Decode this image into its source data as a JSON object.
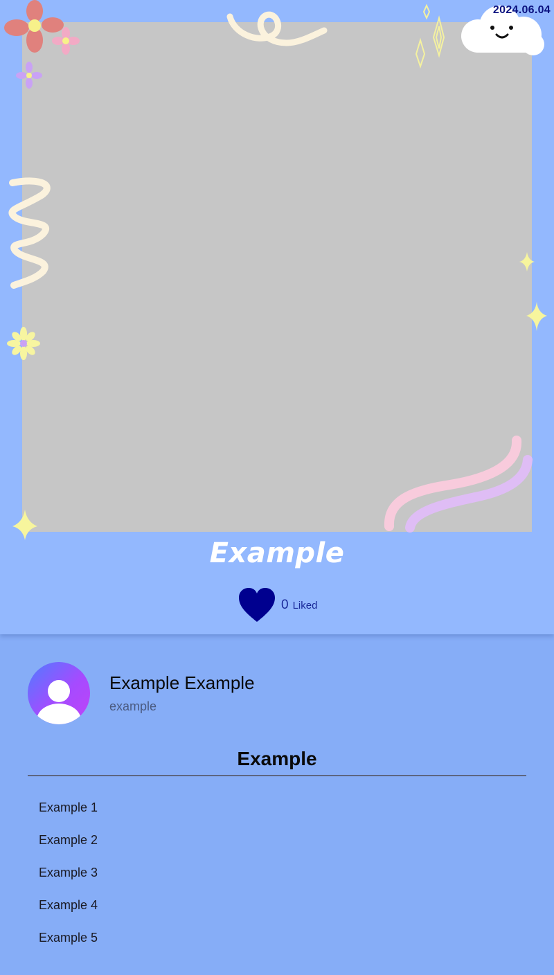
{
  "post": {
    "date": "2024.06.04",
    "caption": "Example",
    "likes": {
      "count": "0",
      "label": "Liked"
    }
  },
  "profile": {
    "name": "Example Example",
    "handle": "example"
  },
  "section": {
    "title": "Example",
    "items": [
      "Example 1",
      "Example 2",
      "Example 3",
      "Example 4",
      "Example 5"
    ]
  },
  "icons": {
    "like": "heart-icon",
    "avatar": "user-silhouette-icon",
    "decorations": [
      "flower-icon",
      "cloud-icon",
      "sparkle-icon",
      "squiggle-icon"
    ]
  },
  "colors": {
    "card_background": "#93b8fe",
    "page_background": "#86adf7",
    "photo_placeholder": "#c6c6c6",
    "heart": "#00008f",
    "date_text": "#0b1280"
  }
}
